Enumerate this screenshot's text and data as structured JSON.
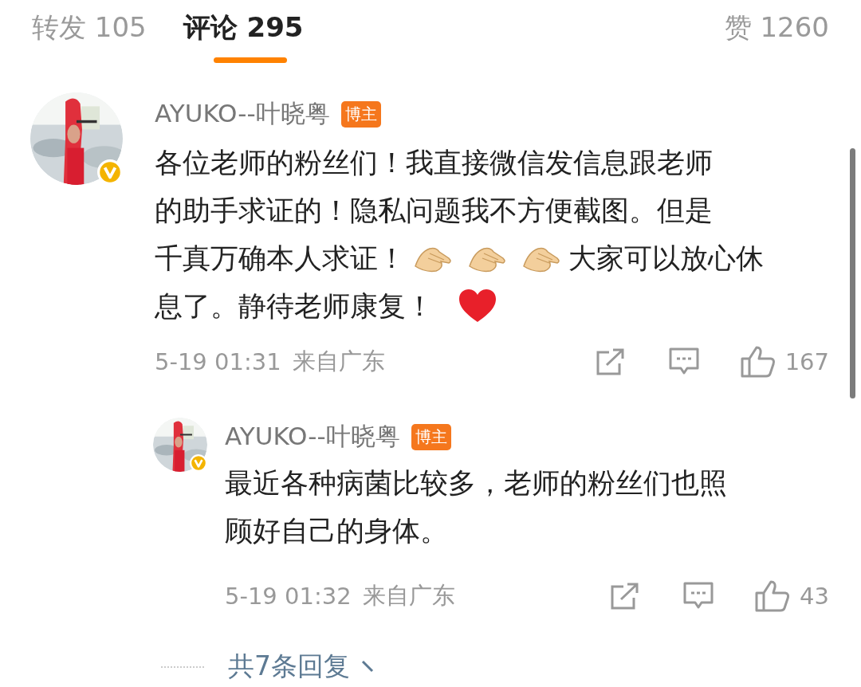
{
  "tabs": [
    {
      "label": "转发 105",
      "selected": false
    },
    {
      "label": "评论 295",
      "selected": true
    },
    {
      "label": "赞 1260",
      "selected": false
    }
  ],
  "comments": [
    {
      "author": "AYUKO--叶晓粤",
      "badge": "博主",
      "verified": true,
      "body": [
        [
          {
            "kind": "text",
            "text": "各位老师的粉丝们！我直接微信发信息跟老师"
          }
        ],
        [
          {
            "kind": "text",
            "text": "的助手求证的！隐私问题我不方便截图。但是"
          }
        ],
        [
          {
            "kind": "text",
            "text": "千真万确本人求证！"
          },
          {
            "kind": "hands"
          },
          {
            "kind": "hands"
          },
          {
            "kind": "hands"
          },
          {
            "kind": "text",
            "text": "大家可以放心休"
          }
        ],
        [
          {
            "kind": "text",
            "text": "息了。静待老师康复！"
          },
          {
            "kind": "heart"
          }
        ]
      ],
      "time": "5-19 01:31",
      "location": "来自广东",
      "likes": "167",
      "replies": [
        {
          "author": "AYUKO--叶晓粤",
          "badge": "博主",
          "verified": true,
          "body": [
            [
              {
                "kind": "text",
                "text": "最近各种病菌比较多，老师的粉丝们也照"
              }
            ],
            [
              {
                "kind": "text",
                "text": "顾好自己的身体。"
              }
            ]
          ],
          "time": "5-19 01:32",
          "location": "来自广东",
          "likes": "43"
        }
      ],
      "more_replies": "共7条回复"
    }
  ]
}
